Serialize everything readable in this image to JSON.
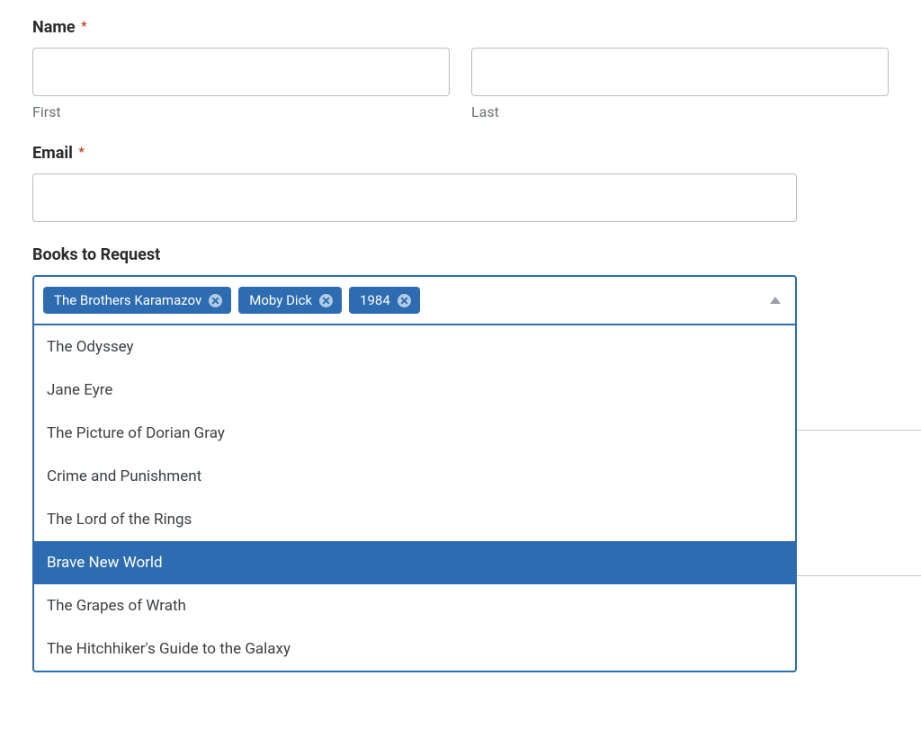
{
  "form": {
    "name": {
      "label": "Name",
      "required_mark": "*",
      "first_sub": "First",
      "last_sub": "Last",
      "first_value": "",
      "last_value": ""
    },
    "email": {
      "label": "Email",
      "required_mark": "*",
      "value": ""
    },
    "books": {
      "label": "Books to Request",
      "selected": [
        {
          "label": "The Brothers Karamazov"
        },
        {
          "label": "Moby Dick"
        },
        {
          "label": "1984"
        }
      ],
      "options": [
        {
          "label": "The Odyssey",
          "highlighted": false
        },
        {
          "label": "Jane Eyre",
          "highlighted": false
        },
        {
          "label": "The Picture of Dorian Gray",
          "highlighted": false
        },
        {
          "label": "Crime and Punishment",
          "highlighted": false
        },
        {
          "label": "The Lord of the Rings",
          "highlighted": false
        },
        {
          "label": "Brave New World",
          "highlighted": true
        },
        {
          "label": "The Grapes of Wrath",
          "highlighted": false
        },
        {
          "label": "The Hitchhiker's Guide to the Galaxy",
          "highlighted": false
        }
      ]
    }
  }
}
